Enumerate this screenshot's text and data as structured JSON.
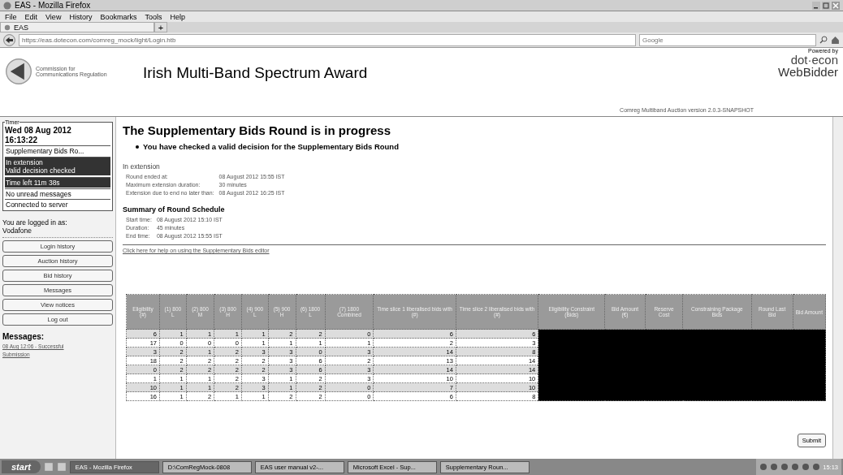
{
  "window": {
    "title": "EAS - Mozilla Firefox"
  },
  "menu": [
    "File",
    "Edit",
    "View",
    "History",
    "Bookmarks",
    "Tools",
    "Help"
  ],
  "tabs": [
    {
      "label": "EAS",
      "selected": true
    }
  ],
  "new_tab": "+",
  "address": "https://eas.dotecon.com/comreg_mock/light/Login.htb",
  "search": {
    "placeholder": "Google"
  },
  "header": {
    "logo_lines": [
      "Commission for",
      "Communications Regulation"
    ],
    "title": "Irish Multi-Band Spectrum Award",
    "version": "Comreg Multiband Auction version 2.0.3-SNAPSHOT",
    "powered_by": "Powered by",
    "brand": "dot·econ",
    "product": "WebBidder"
  },
  "timer": {
    "legend": "Timer",
    "date": "Wed 08 Aug 2012",
    "time": "16:13:22",
    "items": [
      {
        "kind": "plain",
        "lines": [
          "Supplementary Bids Ro..."
        ]
      },
      {
        "kind": "alert",
        "lines": [
          "In extension",
          "Valid decision checked"
        ]
      },
      {
        "kind": "alert",
        "lines": [
          "Time left  11m 38s"
        ]
      },
      {
        "kind": "plain",
        "lines": [
          "No unread messages"
        ]
      },
      {
        "kind": "plain",
        "lines": [
          "Connected to server"
        ]
      }
    ]
  },
  "login": {
    "label": "You are logged in as:",
    "user": "Vodafone"
  },
  "nav_buttons": [
    "Login history",
    "Auction history",
    "Bid history",
    "Messages",
    "View notices",
    "Log out"
  ],
  "messages": {
    "label": "Messages:",
    "links": [
      "08 Aug 12:06 - Successful",
      "Submission"
    ]
  },
  "main": {
    "heading": "The Supplementary Bids Round is in progress",
    "notice": "You have checked a valid decision for the Supplementary Bids Round",
    "extension": {
      "title": "In extension",
      "rows": [
        [
          "Round ended at:",
          "08 August 2012 15:55 IST"
        ],
        [
          "Maximum extension duration:",
          "30 minutes"
        ],
        [
          "Extension due to end no later than:",
          "08 August 2012 16:25 IST"
        ]
      ]
    },
    "schedule": {
      "title": "Summary of Round Schedule",
      "rows": [
        [
          "Start time:",
          "08 August 2012 15:10 IST"
        ],
        [
          "Duration:",
          "45 minutes"
        ],
        [
          "End time:",
          "08 August 2012 15:55 IST"
        ]
      ]
    },
    "help_link": "Click here for help on using the Supplementary Bids editor",
    "submit": "Submit"
  },
  "table": {
    "columns": [
      "Eligibility (#)",
      "(1) 800 L",
      "(2) 800 M",
      "(3) 800 H",
      "(4) 900 L",
      "(5) 900 H",
      "(6) 1800 L",
      "(7) 1800 Combined",
      "Time slice 1 liberalised bids with (#)",
      "Time slice 2 liberalised bids with (#)",
      "Eligibility Constraint (Bids)",
      "Bid Amount (€)",
      "Reserve Cost",
      "Constraining Package Bids",
      "Round Last Bid",
      "Bid Amount"
    ],
    "rows": [
      [
        "6",
        "1",
        "1",
        "1",
        "1",
        "2",
        "2",
        "0",
        "6",
        "6"
      ],
      [
        "17",
        "0",
        "0",
        "0",
        "1",
        "1",
        "1",
        "1",
        "2",
        "3"
      ],
      [
        "3",
        "2",
        "1",
        "2",
        "3",
        "3",
        "0",
        "3",
        "14",
        "8"
      ],
      [
        "18",
        "2",
        "2",
        "2",
        "2",
        "3",
        "6",
        "2",
        "13",
        "14"
      ],
      [
        "0",
        "2",
        "2",
        "2",
        "2",
        "3",
        "6",
        "3",
        "14",
        "14"
      ],
      [
        "1",
        "1",
        "1",
        "2",
        "3",
        "1",
        "2",
        "3",
        "10",
        "10"
      ],
      [
        "10",
        "1",
        "1",
        "2",
        "3",
        "1",
        "2",
        "0",
        "7",
        "10"
      ],
      [
        "16",
        "1",
        "2",
        "1",
        "1",
        "2",
        "2",
        "0",
        "6",
        "8"
      ]
    ]
  },
  "taskbar": {
    "start": "start",
    "items": [
      {
        "label": "EAS - Mozilla Firefox",
        "selected": true
      },
      {
        "label": "D:\\ComRegMock-0808",
        "selected": false
      },
      {
        "label": "EAS user manual v2-...",
        "selected": false
      },
      {
        "label": "Microsoft Excel - Sup...",
        "selected": false
      },
      {
        "label": "Supplementary Roun...",
        "selected": false
      }
    ],
    "clock": "15:13"
  }
}
